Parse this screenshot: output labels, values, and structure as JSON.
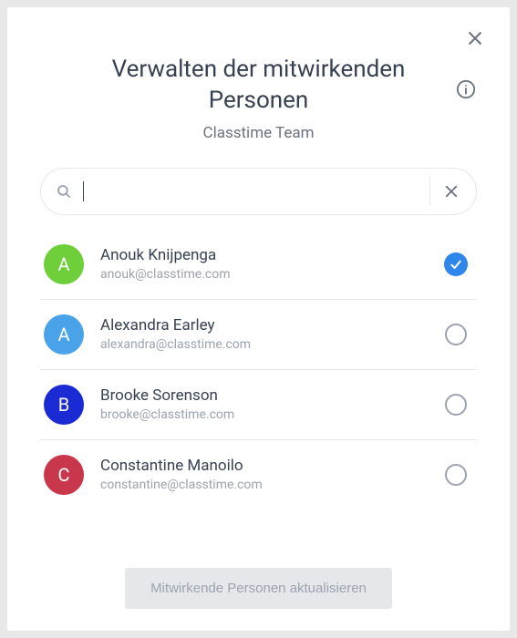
{
  "header": {
    "title": "Verwalten der mitwirkenden Personen",
    "subtitle": "Classtime Team"
  },
  "search": {
    "value": "",
    "placeholder": ""
  },
  "people": [
    {
      "initial": "A",
      "name": "Anouk Knijpenga",
      "email": "anouk@classtime.com",
      "color": "#6fcf3a",
      "selected": true
    },
    {
      "initial": "A",
      "name": "Alexandra Earley",
      "email": "alexandra@classtime.com",
      "color": "#4aa3e8",
      "selected": false
    },
    {
      "initial": "B",
      "name": "Brooke Sorenson",
      "email": "brooke@classtime.com",
      "color": "#1a2bd4",
      "selected": false
    },
    {
      "initial": "C",
      "name": "Constantine Manoilo",
      "email": "constantine@classtime.com",
      "color": "#c9374c",
      "selected": false
    }
  ],
  "footer": {
    "update_label": "Mitwirkende Personen aktualisieren"
  }
}
